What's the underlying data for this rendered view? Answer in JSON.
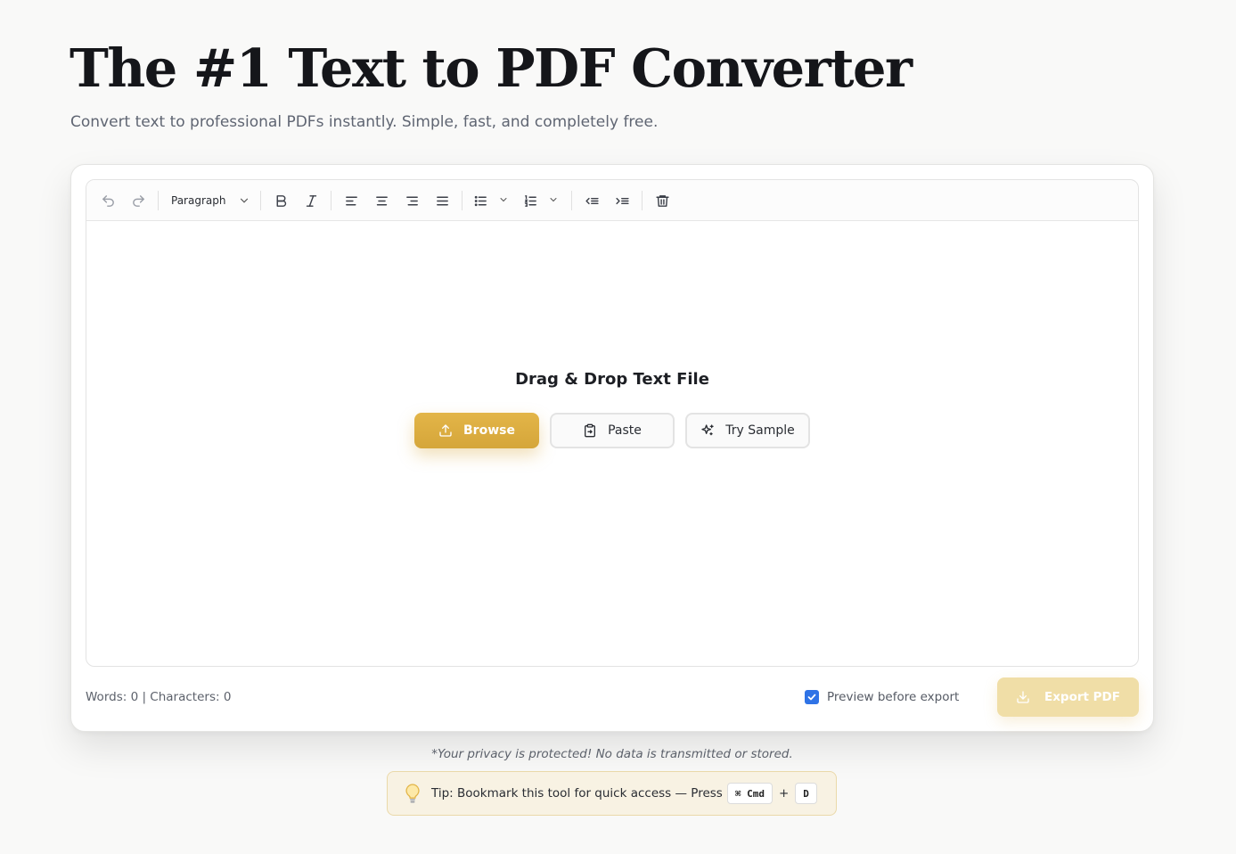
{
  "header": {
    "title": "The #1 Text to PDF Converter",
    "subtitle": "Convert text to professional PDFs instantly. Simple, fast, and completely free."
  },
  "toolbar": {
    "block_format": "Paragraph",
    "icons": [
      "undo-icon",
      "redo-icon",
      "bold-icon",
      "italic-icon",
      "align-left-icon",
      "align-center-icon",
      "align-right-icon",
      "align-justify-icon",
      "bullet-list-icon",
      "numbered-list-icon",
      "outdent-icon",
      "indent-icon",
      "trash-icon"
    ]
  },
  "dropzone": {
    "title": "Drag & Drop Text File",
    "browse_label": "Browse",
    "paste_label": "Paste",
    "sample_label": "Try Sample"
  },
  "footer": {
    "stats": "Words: 0 | Characters: 0",
    "preview_label": "Preview before export",
    "preview_checked": true,
    "export_label": "Export PDF"
  },
  "privacy_note": "*Your privacy is protected! No data is transmitted or stored.",
  "tip": {
    "text": "Tip: Bookmark this tool for quick access — Press",
    "key1": "⌘ Cmd",
    "plus": "+",
    "key2": "D"
  },
  "colors": {
    "accent": "#d9ab3f",
    "accent_disabled": "#f0dea7",
    "checkbox": "#2f73e6",
    "tip_bg": "#f8f2e3"
  }
}
